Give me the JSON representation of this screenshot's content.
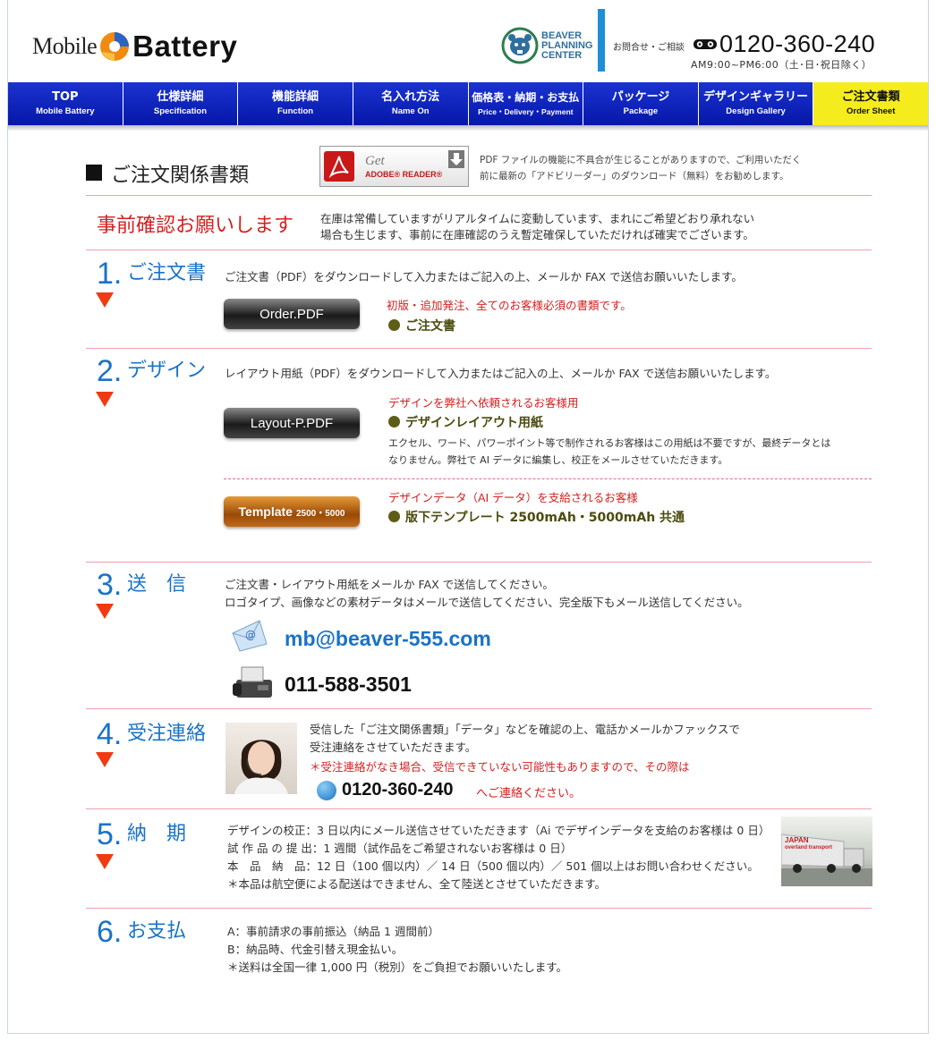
{
  "header": {
    "logo_mobile": "Mobile",
    "logo_battery": "Battery",
    "bpc_lines": [
      "BEAVER",
      "PLANNING",
      "CENTER"
    ],
    "contact_label": "お問合せ・ご相談",
    "phone": "0120-360-240",
    "hours": "AM9:00~PM6:00（土･日･祝日除く）"
  },
  "nav": [
    {
      "jp": "TOP",
      "en": "Mobile Battery"
    },
    {
      "jp": "仕様詳細",
      "en": "Specification"
    },
    {
      "jp": "機能詳細",
      "en": "Function"
    },
    {
      "jp": "名入れ方法",
      "en": "Name On"
    },
    {
      "jp": "価格表・納期・お支払",
      "en": "Price・Delivery・Payment"
    },
    {
      "jp": "パッケージ",
      "en": "Package"
    },
    {
      "jp": "デザインギャラリー",
      "en": "Design Gallery"
    },
    {
      "jp": "ご注文書類",
      "en": "Order Sheet"
    }
  ],
  "page": {
    "title": "ご注文関係書類",
    "adobe_get": "Get",
    "adobe_reader": "ADOBE® READER®",
    "pdf_note": [
      "PDF ファイルの機能に不具合が生じることがありますので、ご利用いただく",
      "前に最新の「アドビリーダー」のダウンロード（無料）をお勧めします。"
    ]
  },
  "precheck": {
    "title": "事前確認お願いします",
    "lines": [
      "在庫は常備していますがリアルタイムに変動しています、まれにご希望どおり承れない",
      "場合も生じます、事前に在庫確認のうえ暫定確保していただければ確実でございます。"
    ]
  },
  "sections": {
    "s1": {
      "num": "1.",
      "title": "ご注文書",
      "text": "ご注文書（PDF）をダウンロードして入力またはご記入の上、メールか FAX で送信お願いいたします。",
      "button": "Order.PDF",
      "note": "初版・追加発注、全てのお客様必須の書類です。",
      "label": "ご注文書"
    },
    "s2": {
      "num": "2.",
      "title": "デザイン",
      "text": "レイアウト用紙（PDF）をダウンロードして入力またはご記入の上、メールか FAX で送信お願いいたします。",
      "button1": "Layout-P.PDF",
      "note1": "デザインを弊社へ依頼されるお客様用",
      "label1": "デザインレイアウト用紙",
      "desc1": [
        "エクセル、ワード、パワーポイント等で制作されるお客様はこの用紙は不要ですが、最終データとは",
        "なりません。弊社で AI データに編集し、校正をメールさせていただきます。"
      ],
      "button2": "Template",
      "button2_small": "2500・5000",
      "note2": "デザインデータ（AI データ）を支給されるお客様",
      "label2": "版下テンプレート 2500mAh・5000mAh 共通"
    },
    "s3": {
      "num": "3.",
      "title": "送　信",
      "lines": [
        "ご注文書・レイアウト用紙をメールか FAX で送信してください。",
        "ロゴタイプ、画像などの素材データはメールで送信してください、完全版下もメール送信してください。"
      ],
      "email": "mb@beaver-555.com",
      "fax": "011-588-3501"
    },
    "s4": {
      "num": "4.",
      "title": "受注連絡",
      "lines": [
        "受信した「ご注文関係書類」「データ」などを確認の上、電話かメールかファックスで",
        "受注連絡をさせていただきます。"
      ],
      "warning": "＊受注連絡がなき場合、受信できていない可能性もありますので、その際は",
      "phone": "0120-360-240",
      "phone_suffix": "へご連絡ください。"
    },
    "s5": {
      "num": "5.",
      "title": "納　期",
      "lines": [
        "デザインの校正：3 日以内にメール送信させていただきます（Ai でデザインデータを支給のお客様は 0 日）",
        "試 作 品 の 提 出：1 週間（試作品をご希望されないお客様は 0 日）",
        "本　品　納　品：12 日（100 個以内）／ 14 日（500 個以内）／ 501 個以上はお問い合わせください。",
        "＊本品は航空便による配送はできません、全て陸送とさせていただきます。"
      ],
      "truck_text": [
        "JAPAN",
        "overland transport"
      ]
    },
    "s6": {
      "num": "6.",
      "title": "お支払",
      "lines": [
        "A：事前請求の事前振込（納品 1 週間前）",
        "B：納品時、代金引替え現金払い。",
        "＊送料は全国一律 1,000 円（税別）をご負担でお願いいたします。"
      ]
    }
  },
  "colors": {
    "nav_bg": "#0a1fb8",
    "nav_active": "#f5ec1e",
    "accent_blue": "#1973c8",
    "accent_red": "#d42020",
    "arrow": "#f03a12"
  }
}
